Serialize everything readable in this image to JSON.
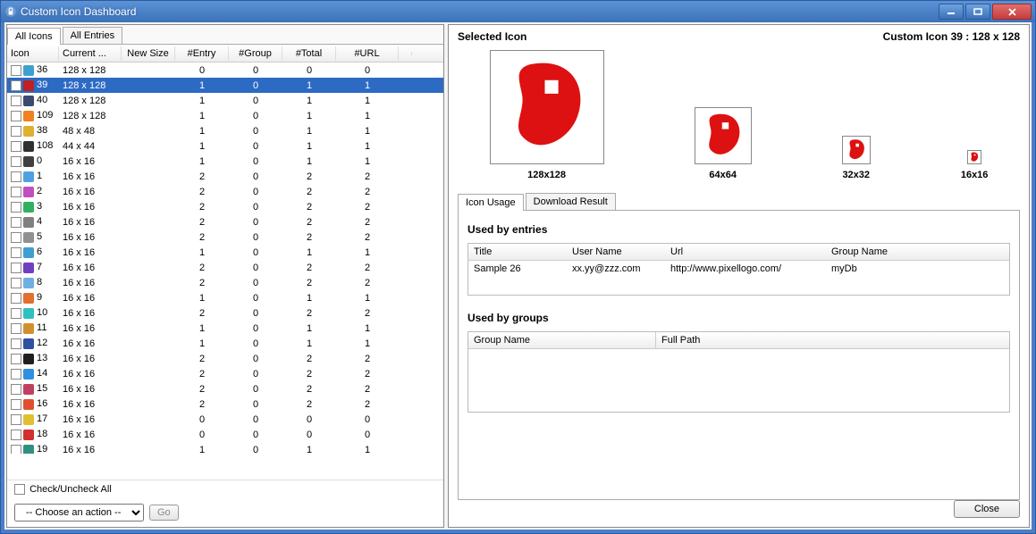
{
  "window": {
    "title": "Custom Icon Dashboard"
  },
  "left_tabs": [
    "All Icons",
    "All Entries"
  ],
  "table": {
    "headers": {
      "icon": "Icon",
      "cur": "Current ...",
      "new": "New Size",
      "entry": "#Entry",
      "group": "#Group",
      "total": "#Total",
      "url": "#URL"
    },
    "rows": [
      {
        "id": "36",
        "color": "#3fa0d0",
        "cur": "128 x 128",
        "new": "",
        "e": 0,
        "g": 0,
        "t": 0,
        "u": 0,
        "sel": false
      },
      {
        "id": "39",
        "color": "#c02020",
        "cur": "128 x 128",
        "new": "",
        "e": 1,
        "g": 0,
        "t": 1,
        "u": 1,
        "sel": true
      },
      {
        "id": "40",
        "color": "#3a4a70",
        "cur": "128 x 128",
        "new": "",
        "e": 1,
        "g": 0,
        "t": 1,
        "u": 1,
        "sel": false
      },
      {
        "id": "109",
        "color": "#f08020",
        "cur": "128 x 128",
        "new": "",
        "e": 1,
        "g": 0,
        "t": 1,
        "u": 1,
        "sel": false
      },
      {
        "id": "38",
        "color": "#e0b030",
        "cur": "48 x 48",
        "new": "",
        "e": 1,
        "g": 0,
        "t": 1,
        "u": 1,
        "sel": false
      },
      {
        "id": "108",
        "color": "#303030",
        "cur": "44 x 44",
        "new": "",
        "e": 1,
        "g": 0,
        "t": 1,
        "u": 1,
        "sel": false
      },
      {
        "id": "0",
        "color": "#404040",
        "cur": "16 x 16",
        "new": "",
        "e": 1,
        "g": 0,
        "t": 1,
        "u": 1,
        "sel": false
      },
      {
        "id": "1",
        "color": "#50a0e0",
        "cur": "16 x 16",
        "new": "",
        "e": 2,
        "g": 0,
        "t": 2,
        "u": 2,
        "sel": false
      },
      {
        "id": "2",
        "color": "#c050c0",
        "cur": "16 x 16",
        "new": "",
        "e": 2,
        "g": 0,
        "t": 2,
        "u": 2,
        "sel": false
      },
      {
        "id": "3",
        "color": "#30b060",
        "cur": "16 x 16",
        "new": "",
        "e": 2,
        "g": 0,
        "t": 2,
        "u": 2,
        "sel": false
      },
      {
        "id": "4",
        "color": "#808080",
        "cur": "16 x 16",
        "new": "",
        "e": 2,
        "g": 0,
        "t": 2,
        "u": 2,
        "sel": false
      },
      {
        "id": "5",
        "color": "#909090",
        "cur": "16 x 16",
        "new": "",
        "e": 2,
        "g": 0,
        "t": 2,
        "u": 2,
        "sel": false
      },
      {
        "id": "6",
        "color": "#3fa0d0",
        "cur": "16 x 16",
        "new": "",
        "e": 1,
        "g": 0,
        "t": 1,
        "u": 1,
        "sel": false
      },
      {
        "id": "7",
        "color": "#7040c0",
        "cur": "16 x 16",
        "new": "",
        "e": 2,
        "g": 0,
        "t": 2,
        "u": 2,
        "sel": false
      },
      {
        "id": "8",
        "color": "#70b0e0",
        "cur": "16 x 16",
        "new": "",
        "e": 2,
        "g": 0,
        "t": 2,
        "u": 2,
        "sel": false
      },
      {
        "id": "9",
        "color": "#e07030",
        "cur": "16 x 16",
        "new": "",
        "e": 1,
        "g": 0,
        "t": 1,
        "u": 1,
        "sel": false
      },
      {
        "id": "10",
        "color": "#30c0c0",
        "cur": "16 x 16",
        "new": "",
        "e": 2,
        "g": 0,
        "t": 2,
        "u": 2,
        "sel": false
      },
      {
        "id": "11",
        "color": "#d09030",
        "cur": "16 x 16",
        "new": "",
        "e": 1,
        "g": 0,
        "t": 1,
        "u": 1,
        "sel": false
      },
      {
        "id": "12",
        "color": "#3050a0",
        "cur": "16 x 16",
        "new": "",
        "e": 1,
        "g": 0,
        "t": 1,
        "u": 1,
        "sel": false
      },
      {
        "id": "13",
        "color": "#202020",
        "cur": "16 x 16",
        "new": "",
        "e": 2,
        "g": 0,
        "t": 2,
        "u": 2,
        "sel": false
      },
      {
        "id": "14",
        "color": "#3090e0",
        "cur": "16 x 16",
        "new": "",
        "e": 2,
        "g": 0,
        "t": 2,
        "u": 2,
        "sel": false
      },
      {
        "id": "15",
        "color": "#c04060",
        "cur": "16 x 16",
        "new": "",
        "e": 2,
        "g": 0,
        "t": 2,
        "u": 2,
        "sel": false
      },
      {
        "id": "16",
        "color": "#e05030",
        "cur": "16 x 16",
        "new": "",
        "e": 2,
        "g": 0,
        "t": 2,
        "u": 2,
        "sel": false
      },
      {
        "id": "17",
        "color": "#e0c030",
        "cur": "16 x 16",
        "new": "",
        "e": 0,
        "g": 0,
        "t": 0,
        "u": 0,
        "sel": false
      },
      {
        "id": "18",
        "color": "#d03030",
        "cur": "16 x 16",
        "new": "",
        "e": 0,
        "g": 0,
        "t": 0,
        "u": 0,
        "sel": false
      },
      {
        "id": "19",
        "color": "#309080",
        "cur": "16 x 16",
        "new": "",
        "e": 1,
        "g": 0,
        "t": 1,
        "u": 1,
        "sel": false
      }
    ]
  },
  "check_uncheck": "Check/Uncheck All",
  "action_select": "-- Choose an action --",
  "go": "Go",
  "right": {
    "selected": "Selected Icon",
    "title": "Custom Icon 39 : 128 x 128",
    "previews": {
      "p128": "128x128",
      "p64": "64x64",
      "p32": "32x32",
      "p16": "16x16"
    },
    "tabs": [
      "Icon Usage",
      "Download Result"
    ],
    "used_entries": "Used by entries",
    "used_groups": "Used by groups",
    "entries_headers": {
      "title": "Title",
      "user": "User Name",
      "url": "Url",
      "group": "Group Name"
    },
    "entries_rows": [
      {
        "title": "Sample 26",
        "user": "xx.yy@zzz.com",
        "url": "http://www.pixellogo.com/",
        "group": "myDb"
      }
    ],
    "groups_headers": {
      "name": "Group Name",
      "path": "Full Path"
    },
    "close": "Close"
  }
}
